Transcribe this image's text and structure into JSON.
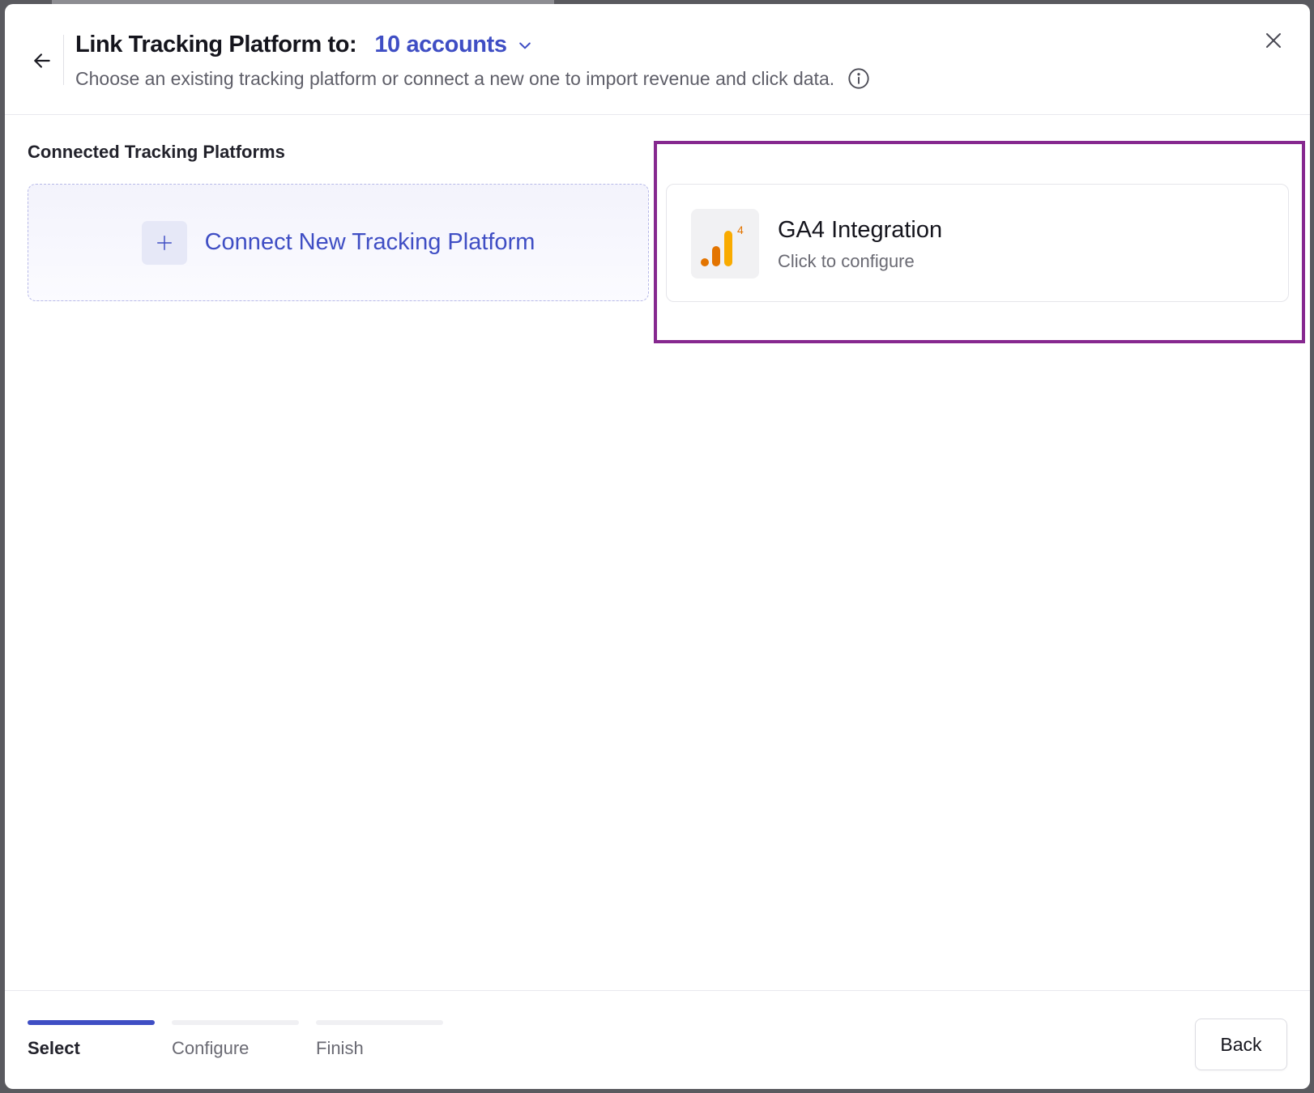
{
  "header": {
    "title": "Link Tracking Platform to:",
    "accounts_label": "10 accounts",
    "subtitle": "Choose an existing tracking platform or connect a new one to import revenue and click data."
  },
  "section": {
    "title": "Connected Tracking Platforms"
  },
  "connect_card": {
    "label": "Connect New Tracking Platform"
  },
  "platforms": [
    {
      "name": "GA4 Integration",
      "subtitle": "Click to configure",
      "logo_icon": "google-analytics-4-icon",
      "logo_badge": "4"
    }
  ],
  "steps": [
    {
      "label": "Select",
      "active": true
    },
    {
      "label": "Configure",
      "active": false
    },
    {
      "label": "Finish",
      "active": false
    }
  ],
  "footer": {
    "back_label": "Back"
  },
  "colors": {
    "accent": "#3f4ec4",
    "highlight": "#86288f",
    "ga_dark": "#e37400",
    "ga_light": "#f9ab00"
  }
}
